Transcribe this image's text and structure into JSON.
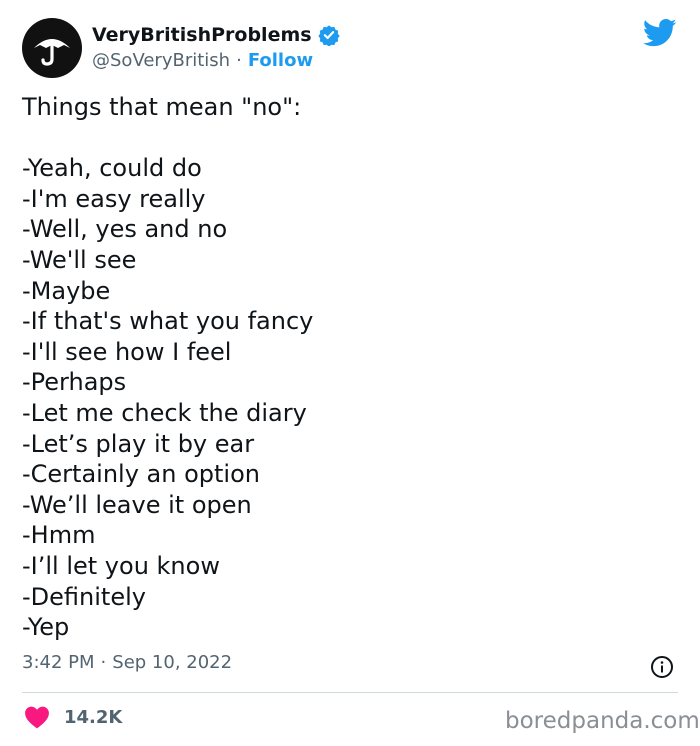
{
  "author": {
    "display_name": "VeryBritishProblems",
    "handle": "@SoVeryBritish",
    "separator": "·",
    "follow_label": "Follow"
  },
  "tweet": {
    "lines": [
      "Things that mean \"no\":",
      "",
      "-Yeah, could do",
      "-I'm easy really",
      "-Well, yes and no",
      "-We'll see",
      "-Maybe",
      "-If that's what you fancy",
      "-I'll see how I feel",
      "-Perhaps",
      "-Let me check the diary",
      "-Let’s play it by ear",
      "-Certainly an option",
      "-We’ll leave it open",
      "-Hmm",
      "-I’ll let you know",
      "-Definitely",
      "-Yep"
    ],
    "time": "3:42 PM",
    "separator": "·",
    "date": "Sep 10, 2022"
  },
  "engagement": {
    "likes": "14.2K"
  },
  "watermark": "boredpanda.com",
  "icons": {
    "avatar": "umbrella-icon",
    "verified": "verified-badge-icon",
    "platform": "twitter-bird-icon",
    "info": "info-icon",
    "like": "heart-icon"
  },
  "colors": {
    "accent": "#1d9bf0",
    "heart": "#f91880",
    "text": "#0f1419",
    "muted": "#536471"
  }
}
